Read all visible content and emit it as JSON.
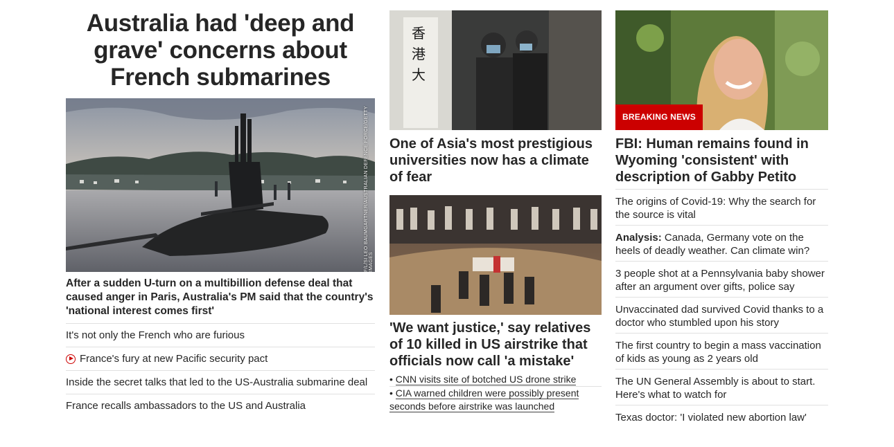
{
  "col1": {
    "lead_title": "Australia had 'deep and grave' concerns about French submarines",
    "hero_credit": "F/L/SI LEO BAUMGARTNER/AUSTRALIAN DEFENCE FORCE/GETTY IMAGES",
    "hero_caption": "After a sudden U-turn on a multibillion defense deal that caused anger in Paris, Australia's PM said that the country's 'national interest comes first'",
    "links": [
      "It's not only the French who are furious",
      "France's fury at new Pacific security pact",
      "Inside the secret talks that led to the US-Australia submarine deal",
      "France recalls ambassadors to the US and Australia"
    ]
  },
  "col2": {
    "headline_a": "One of Asia's most prestigious universities now has a climate of fear",
    "headline_b": "'We want justice,' say relatives of 10 killed in US airstrike that officials now call 'a mistake'",
    "bullets": [
      "CNN visits site of botched US drone strike",
      "CIA warned children were possibly present seconds before airstrike was launched"
    ]
  },
  "col3": {
    "badge": "BREAKING NEWS",
    "headline": "FBI: Human remains found in Wyoming 'consistent' with description of Gabby Petito",
    "links": [
      {
        "prefix": "",
        "text": "The origins of Covid-19: Why the search for the source is vital"
      },
      {
        "prefix": "Analysis:",
        "text": " Canada, Germany vote on the heels of deadly weather. Can climate win?"
      },
      {
        "prefix": "",
        "text": "3 people shot at a Pennsylvania baby shower after an argument over gifts, police say"
      },
      {
        "prefix": "",
        "text": "Unvaccinated dad survived Covid thanks to a doctor who stumbled upon his story"
      },
      {
        "prefix": "",
        "text": "The first country to begin a mass vaccination of kids as young as 2 years old"
      },
      {
        "prefix": "",
        "text": "The UN General Assembly is about to start. Here's what to watch for"
      },
      {
        "prefix": "",
        "text": "Texas doctor: 'I violated new abortion law'"
      }
    ]
  },
  "colors": {
    "accent": "#cc0000",
    "text": "#262626",
    "divider": "#e0e0e0"
  }
}
